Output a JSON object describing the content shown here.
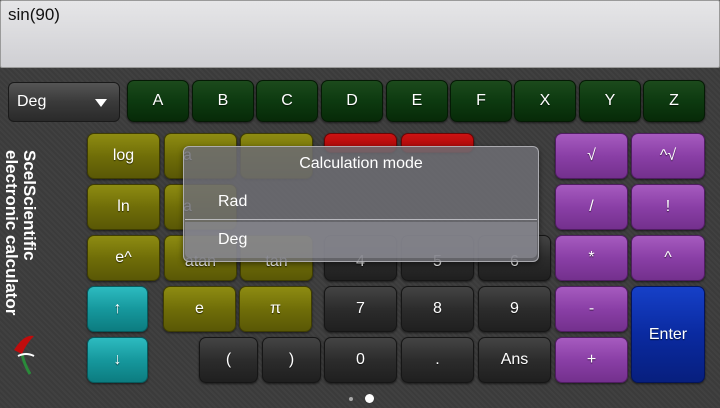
{
  "display": {
    "expression": "sin(90)"
  },
  "mode_select": {
    "value": "Deg"
  },
  "variable_keys": [
    "A",
    "B",
    "C",
    "D",
    "E",
    "F",
    "X",
    "Y",
    "Z"
  ],
  "function_keys": {
    "log": "log",
    "ln": "ln",
    "e_pow": "e^",
    "a1": "a",
    "a2": "a",
    "atan": "atan",
    "tan": "tan",
    "e_const": "e",
    "pi": "π",
    "up": "↑",
    "down": "↓"
  },
  "number_keys": {
    "four": "4",
    "five": "5",
    "six": "6",
    "seven": "7",
    "eight": "8",
    "nine": "9",
    "lparen": "(",
    "rparen": ")",
    "zero": "0",
    "dot": ".",
    "ans": "Ans"
  },
  "operator_keys": {
    "sqrt": "√",
    "nthroot": "^√",
    "divide": "/",
    "factorial": "!",
    "multiply": "*",
    "power": "^",
    "minus": "-",
    "plus": "+",
    "enter": "Enter"
  },
  "brand": {
    "line1": "ScelScientific",
    "line2": "electronic calculator"
  },
  "dialog": {
    "title": "Calculation mode",
    "options": [
      "Rad",
      "Deg"
    ]
  },
  "colors": {
    "variable_keys": "#0d3a10",
    "function_keys": "#706e08",
    "arrow_keys": "#16989d",
    "number_keys": "#2c2c2c",
    "operator_keys": "#8a3fa6",
    "enter_key": "#0a2aa0",
    "accent_red": "#c00c0c"
  }
}
